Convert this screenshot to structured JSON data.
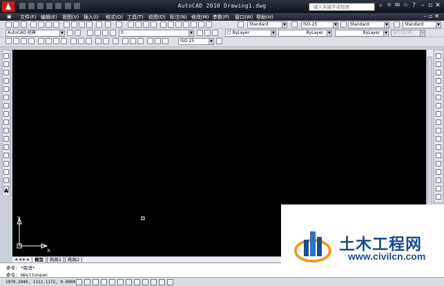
{
  "app": {
    "title": "AutoCAD 2010  Drawing1.dwg",
    "search_placeholder": "键入关键字或短语"
  },
  "menu": [
    "文件(F)",
    "编辑(E)",
    "视图(V)",
    "插入(I)",
    "格式(O)",
    "工具(T)",
    "绘图(D)",
    "标注(N)",
    "修改(M)",
    "参数(P)",
    "窗口(W)",
    "帮助(H)"
  ],
  "toolbars": {
    "text_style": "Standard",
    "dim_style": "ISO-25",
    "table_style": "Standard",
    "multileader_style": "Standard",
    "workspace": "AutoCAD 经典",
    "layer": "0",
    "color": "ByLayer",
    "linetype": "ByLayer",
    "lineweight": "ByLayer",
    "plot_style": "BYCOLOR",
    "dim_style_2": "ISO-25"
  },
  "ucs": {
    "x_label": "X",
    "y_label": "Y"
  },
  "layout_tabs": [
    {
      "label": "模型",
      "active": true
    },
    {
      "label": "布局1",
      "active": false
    },
    {
      "label": "布局2",
      "active": false
    }
  ],
  "command_line": {
    "history": "命令:  *取消*",
    "current": "命令:  mbuttonpan"
  },
  "status": {
    "coordinates": "1970.2940,  1122.1172, 0.0000"
  },
  "watermark": {
    "title": "土木工程网",
    "url": "www.civilcn.com"
  },
  "colors": {
    "canvas": "#000000",
    "title_bar": "#1b2029",
    "watermark_blue": "#1a4c8f",
    "watermark_orange": "#f39a1e"
  }
}
